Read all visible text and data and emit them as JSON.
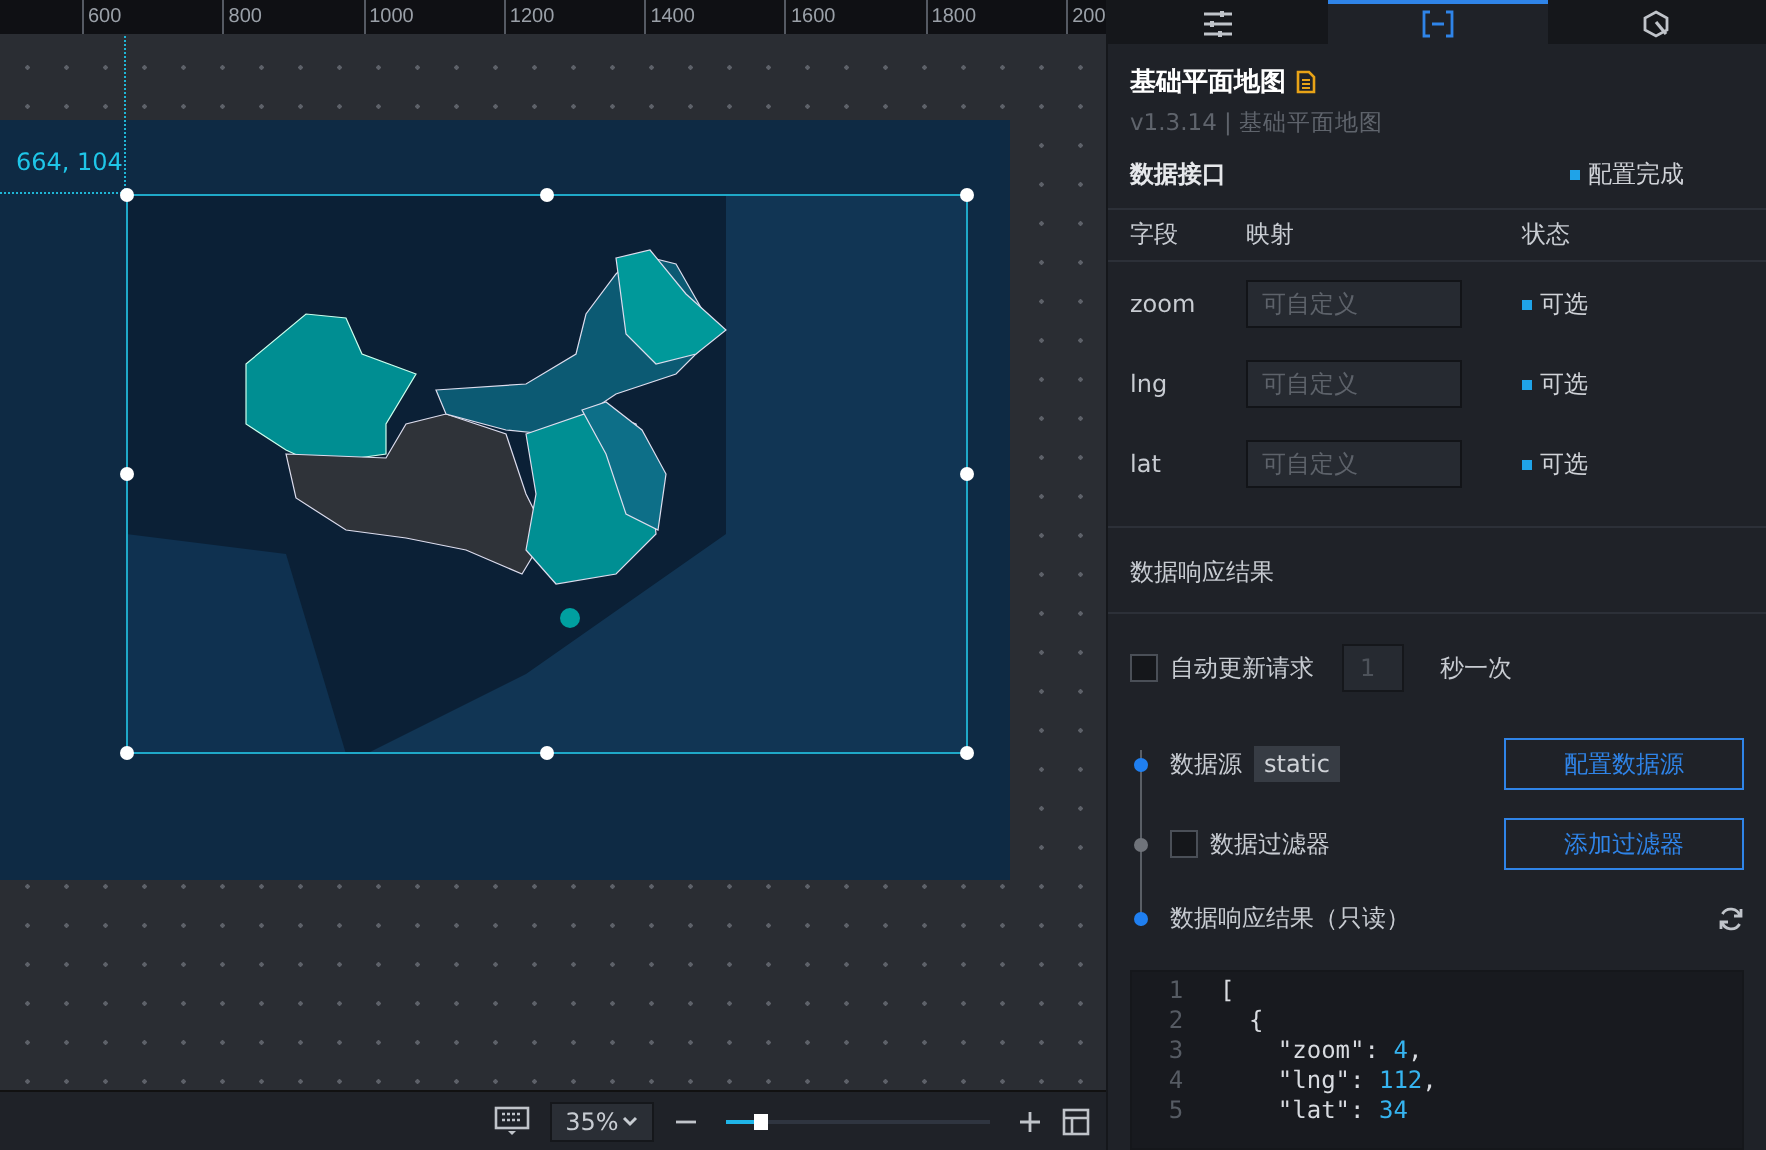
{
  "ruler": {
    "labels": [
      "600",
      "800",
      "1000",
      "1200",
      "1400",
      "1600",
      "1800",
      "200"
    ]
  },
  "canvas": {
    "coordinates": "664, 104"
  },
  "bottom_bar": {
    "zoom": "35%",
    "zoom_slider": {
      "level": 0.13
    }
  },
  "tabs": [
    {
      "selected": false
    },
    {
      "selected": true
    },
    {
      "selected": false
    }
  ],
  "component": {
    "title": "基础平面地图",
    "version": "v1.3.14 | 基础平面地图"
  },
  "data_interface": {
    "title": "数据接口",
    "status": "配置完成",
    "columns": [
      "字段",
      "映射",
      "状态"
    ],
    "fields": [
      {
        "name": "zoom",
        "placeholder": "可自定义",
        "status": "可选"
      },
      {
        "name": "lng",
        "placeholder": "可自定义",
        "status": "可选"
      },
      {
        "name": "lat",
        "placeholder": "可自定义",
        "status": "可选"
      }
    ]
  },
  "response": {
    "title": "数据响应结果",
    "auto_update": {
      "checked": false,
      "label": "自动更新请求",
      "interval": "1",
      "unit": "秒一次"
    },
    "steps": [
      {
        "kind": "source",
        "active": true,
        "label": "数据源",
        "tag": "static",
        "button": "配置数据源"
      },
      {
        "kind": "filter",
        "active": false,
        "checked": false,
        "label": "数据过滤器",
        "button": "添加过滤器"
      },
      {
        "kind": "result",
        "active": true,
        "label": "数据响应结果（只读）"
      }
    ],
    "code": {
      "line_numbers": [
        "1",
        "2",
        "3",
        "4",
        "5"
      ],
      "lines": [
        "[",
        "  {",
        "    \"zoom\": 4,",
        "    \"lng\": 112,",
        "    \"lat\": 34"
      ]
    }
  }
}
